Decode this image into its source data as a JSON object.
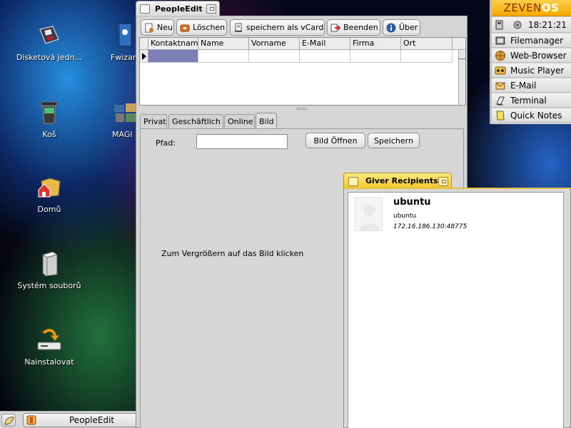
{
  "desktop": {
    "icons": [
      {
        "label": "Disketová jedn..."
      },
      {
        "label": "Fwizar"
      },
      {
        "label": "Koš"
      },
      {
        "label": "MAGI"
      },
      {
        "label": "Domů"
      },
      {
        "label": "Systém souborů"
      },
      {
        "label": "Nainstalovat"
      }
    ]
  },
  "people_edit": {
    "title": "PeopleEdit",
    "toolbar": {
      "new": "Neu",
      "delete": "Löschen",
      "save_vcard": "speichern als vCard",
      "quit": "Beenden",
      "about": "Über"
    },
    "columns": [
      "Kontaktnam",
      "Name",
      "Vorname",
      "E-Mail",
      "Firma",
      "Ort"
    ],
    "tabs": [
      "Privat",
      "Geschäftlich",
      "Online",
      "Bild"
    ],
    "active_tab": "Bild",
    "bild": {
      "path_label": "Pfad:",
      "path_value": "",
      "open_button": "Bild Öffnen",
      "save_button": "Speichern",
      "hint": "Zum Vergrößern auf das Bild klicken"
    }
  },
  "giver": {
    "title": "Giver Recipients",
    "recipient": {
      "name": "ubuntu",
      "user": "ubuntu",
      "address": "172.16.186.130:48775"
    }
  },
  "zevenos_panel": {
    "logo_left": "ZEVEN",
    "logo_right": "OS",
    "clock": "18:21:21",
    "items": [
      {
        "label": "Filemanager",
        "icon": "filemanager-icon"
      },
      {
        "label": "Web-Browser",
        "icon": "web-browser-icon"
      },
      {
        "label": "Music Player",
        "icon": "music-player-icon"
      },
      {
        "label": "E-Mail",
        "icon": "email-icon"
      },
      {
        "label": "Terminal",
        "icon": "terminal-icon"
      },
      {
        "label": "Quick Notes",
        "icon": "quick-notes-icon"
      }
    ]
  },
  "taskbar": {
    "task_label": "PeopleEdit"
  }
}
